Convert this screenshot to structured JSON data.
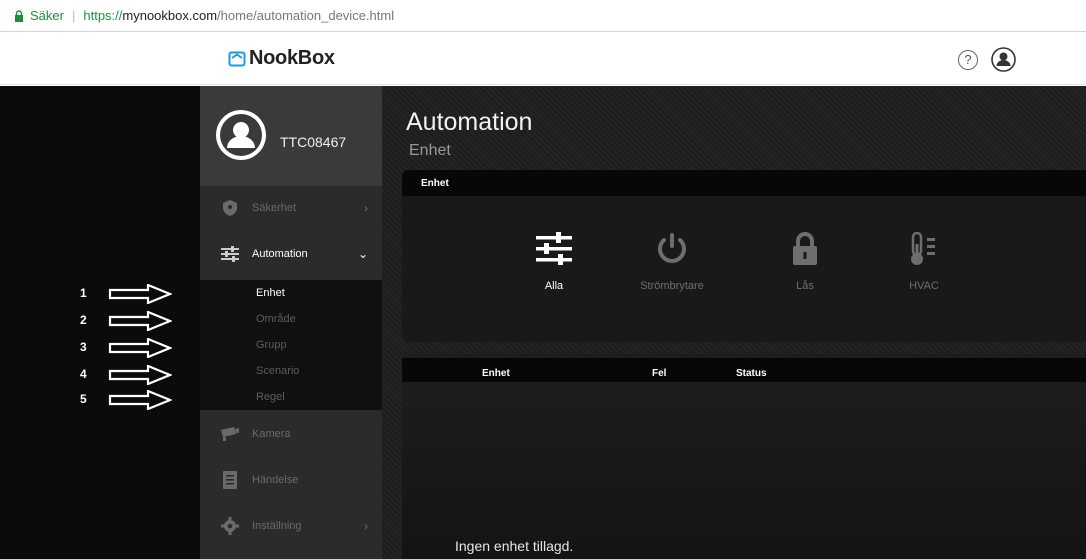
{
  "browser": {
    "secure_label": "Säker",
    "url_proto": "https://",
    "url_host": "mynookbox.com",
    "url_path": "/home/automation_device.html"
  },
  "header": {
    "brand": "NookBox",
    "help_glyph": "?"
  },
  "annotations": [
    "1",
    "2",
    "3",
    "4",
    "5"
  ],
  "sidebar": {
    "username": "TTC08467",
    "items": [
      {
        "label": "Säkerhet",
        "icon": "shield-icon",
        "chevron": "›"
      },
      {
        "label": "Automation",
        "icon": "sliders-icon",
        "chevron": "⌄"
      },
      {
        "label": "Kamera",
        "icon": "camera-icon"
      },
      {
        "label": "Händelse",
        "icon": "event-log-icon"
      },
      {
        "label": "Inställning",
        "icon": "gear-icon",
        "chevron": "›"
      }
    ],
    "sub_items": [
      "Enhet",
      "Område",
      "Grupp",
      "Scenario",
      "Regel"
    ]
  },
  "main": {
    "title": "Automation",
    "subtitle": "Enhet",
    "panel_header": "Enhet",
    "device_types": [
      {
        "label": "Alla",
        "icon": "sliders-icon"
      },
      {
        "label": "Strömbrytare",
        "icon": "power-icon"
      },
      {
        "label": "Lås",
        "icon": "lock-icon"
      },
      {
        "label": "HVAC",
        "icon": "thermometer-icon"
      }
    ],
    "table_headers": [
      "Enhet",
      "Fel",
      "Status"
    ],
    "empty_message": "Ingen enhet tillagd."
  },
  "colors": {
    "secure_green": "#1e8e3e",
    "sidebar_bg": "#2b2b2b",
    "active_text": "#ffffff",
    "inactive_text": "#6a6a6a"
  }
}
